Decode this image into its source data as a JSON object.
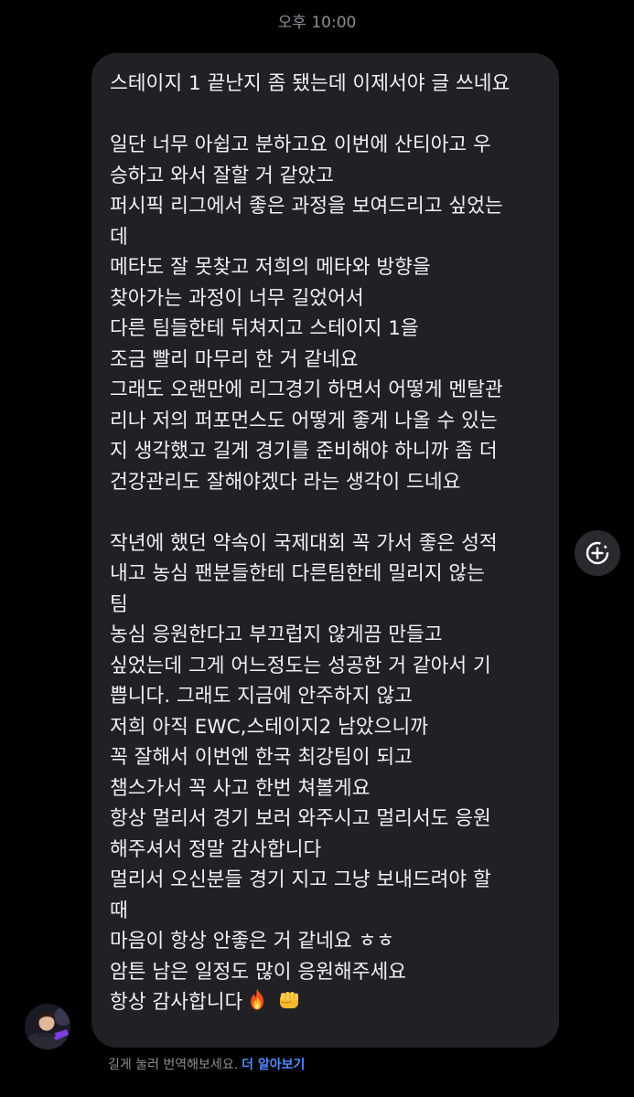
{
  "timestamp": "오후 10:00",
  "message": {
    "lines": [
      "스테이지 1 끝난지 좀 됐는데 이제서야 글 쓰네요",
      "",
      "일단 너무 아쉽고 분하고요 이번에 산티아고 우",
      "승하고 와서 잘할 거 같았고",
      "퍼시픽 리그에서 좋은 과정을 보여드리고 싶었는",
      "데",
      "메타도 잘 못찾고 저희의 메타와 방향을",
      "찾아가는 과정이 너무 길었어서",
      "다른 팀들한테 뒤쳐지고 스테이지 1을",
      "조금 빨리 마무리 한 거 같네요",
      "그래도 오랜만에 리그경기 하면서 어떻게 멘탈관",
      "리나 저의 퍼포먼스도 어떻게 좋게 나올 수 있는",
      "지 생각했고 길게 경기를 준비해야 하니까 좀 더",
      "건강관리도 잘해야겠다 라는 생각이 드네요",
      "",
      "작년에 했던 약속이 국제대회 꼭 가서 좋은 성적",
      "내고 농심 팬분들한테 다른팀한테 밀리지 않는",
      "팀",
      "농심 응원한다고 부끄럽지 않게끔 만들고",
      "싶었는데 그게 어느정도는 성공한 거 같아서 기",
      "쁩니다. 그래도 지금에 안주하지 않고",
      "저희 아직 EWC,스테이지2 남았으니까",
      "꼭 잘해서 이번엔 한국 최강팀이 되고",
      "챔스가서 꼭 사고 한번 쳐볼게요",
      "항상 멀리서 경기 보러 와주시고 멀리서도 응원",
      "해주셔서 정말 감사합니다",
      "멀리서 오신분들 경기 지고 그냥 보내드려야 할",
      "때",
      "마음이 항상 안좋은 거 같네요 ㅎㅎ",
      "암튼 남은 일정도 많이 응원해주세요"
    ],
    "last_line": "항상 감사합니다",
    "last_line_emojis": [
      "fire-emoji",
      "fist-emoji"
    ]
  },
  "share_button_icon": "add-circle-icon",
  "footer": {
    "hint": "길게 눌러 번역해보세요.",
    "link": "더 알아보기"
  },
  "colors": {
    "background": "#000000",
    "bubble": "#212125",
    "text": "#f1f1f3",
    "muted": "#8e8e95",
    "link": "#4e8cff"
  }
}
